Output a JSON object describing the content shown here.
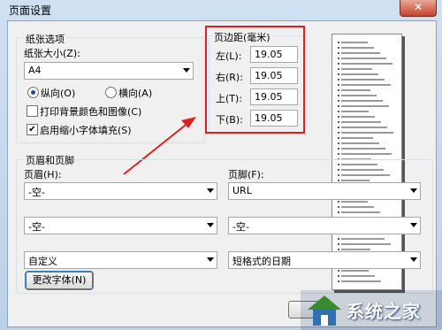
{
  "window": {
    "title": "页面设置",
    "close_glyph": "✕"
  },
  "paper": {
    "group_label": "纸张选项",
    "size_label": "纸张大小(Z):",
    "size_value": "A4",
    "portrait_label": "纵向(O)",
    "landscape_label": "横向(A)",
    "orientation_selected": "portrait",
    "print_bg_label": "打印背景颜色和图像(C)",
    "print_bg_checked": false,
    "shrink_label": "启用缩小字体填充(S)",
    "shrink_checked": true
  },
  "margins": {
    "group_label": "页边距(毫米)",
    "left_label": "左(L):",
    "left_value": "19.05",
    "right_label": "右(R):",
    "right_value": "19.05",
    "top_label": "上(T):",
    "top_value": "19.05",
    "bottom_label": "下(B):",
    "bottom_value": "19.05"
  },
  "header_footer": {
    "group_label": "页眉和页脚",
    "header_label": "页眉(H):",
    "footer_label": "页脚(F):",
    "header_row1": "-空-",
    "footer_row1": "URL",
    "header_row2": "-空-",
    "footer_row2": "-空-",
    "header_row3": "自定义",
    "footer_row3": "短格式的日期",
    "font_button": "更改字体(N)"
  },
  "watermark": {
    "text": "系统之家"
  },
  "colors": {
    "annotation": "#e02020",
    "check_mark": "✔"
  }
}
